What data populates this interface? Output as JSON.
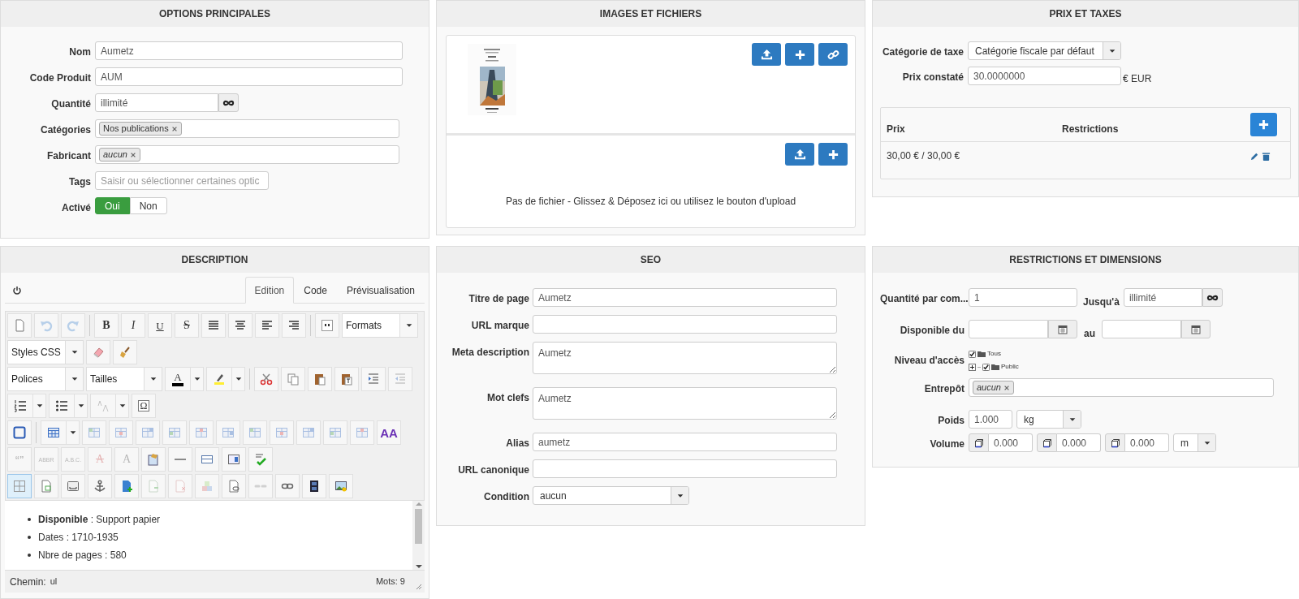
{
  "options": {
    "title": "OPTIONS PRINCIPALES",
    "fields": [
      {
        "kind": "text",
        "label": "Nom",
        "value": "Aumetz"
      },
      {
        "kind": "text",
        "label": "Code Produit",
        "value": "AUM"
      },
      {
        "kind": "unlimited",
        "label": "Quantité",
        "value": "illimité"
      },
      {
        "kind": "tags",
        "label": "Catégories",
        "tags": [
          {
            "text": "Nos publications",
            "italic": false
          }
        ]
      },
      {
        "kind": "tags",
        "label": "Fabricant",
        "tags": [
          {
            "text": "aucun",
            "italic": true
          }
        ]
      },
      {
        "kind": "short",
        "label": "Tags",
        "placeholder": "Saisir ou sélectionner certaines optic"
      },
      {
        "kind": "toggle",
        "label": "Activé",
        "options": [
          {
            "label": "Oui",
            "selected": true
          },
          {
            "label": "Non",
            "selected": false
          }
        ]
      }
    ]
  },
  "images": {
    "title": "IMAGES ET FICHIERS",
    "files_empty_text": "Pas de fichier - Glissez & Déposez ici ou utilisez le bouton d'upload"
  },
  "prices": {
    "title": "PRIX ET TAXES",
    "tax_category": {
      "label": "Catégorie de taxe",
      "value": "Catégorie fiscale par défaut"
    },
    "list_price": {
      "label": "Prix constaté",
      "value": "30.0000000",
      "unit": "€ EUR"
    },
    "table": {
      "columns": [
        "Prix",
        "Restrictions"
      ],
      "rows": [
        {
          "price": "30,00 € / 30,00 €"
        }
      ]
    }
  },
  "description": {
    "title": "DESCRIPTION",
    "tabs": [
      {
        "label": "Edition",
        "selected": true
      },
      {
        "label": "Code",
        "selected": false
      },
      {
        "label": "Prévisualisation",
        "selected": false
      }
    ],
    "toolbar": [
      [
        {
          "kind": "button",
          "disabled": false,
          "active": false
        },
        {
          "kind": "button",
          "disabled": true,
          "active": false
        },
        {
          "kind": "button",
          "disabled": true,
          "active": false
        },
        {
          "kind": "separator"
        },
        {
          "kind": "text",
          "label": "B",
          "disabled": false,
          "active": false
        },
        {
          "kind": "text",
          "label": "I",
          "disabled": false,
          "active": false
        },
        {
          "kind": "text",
          "label": "U",
          "disabled": false,
          "active": false
        },
        {
          "kind": "text",
          "label": "S",
          "disabled": false,
          "active": false
        },
        {
          "kind": "button",
          "disabled": false,
          "active": false
        },
        {
          "kind": "button",
          "disabled": false,
          "active": false
        },
        {
          "kind": "button",
          "disabled": false,
          "active": false
        },
        {
          "kind": "button",
          "disabled": false,
          "active": false
        },
        {
          "kind": "separator"
        },
        {
          "kind": "button",
          "disabled": false,
          "active": false
        },
        {
          "kind": "select",
          "label": "Formats"
        }
      ],
      [
        {
          "kind": "select",
          "label": "Styles CSS"
        },
        {
          "kind": "button",
          "disabled": false,
          "active": false
        },
        {
          "kind": "button",
          "disabled": false,
          "active": false
        }
      ],
      [
        {
          "kind": "select",
          "label": "Polices"
        },
        {
          "kind": "select",
          "label": "Tailles"
        },
        {
          "kind": "split",
          "label": "A",
          "disabled": false,
          "active": false
        },
        {
          "kind": "split",
          "disabled": false,
          "active": false
        },
        {
          "kind": "separator"
        },
        {
          "kind": "button",
          "disabled": false,
          "active": false
        },
        {
          "kind": "button",
          "disabled": false,
          "active": false
        },
        {
          "kind": "button",
          "disabled": false,
          "active": false
        },
        {
          "kind": "button",
          "disabled": false,
          "active": false
        },
        {
          "kind": "button",
          "disabled": false,
          "active": false
        },
        {
          "kind": "button",
          "disabled": true,
          "active": false
        }
      ],
      [
        {
          "kind": "split",
          "disabled": false,
          "active": false
        },
        {
          "kind": "split",
          "disabled": false,
          "active": false
        },
        {
          "kind": "split",
          "disabled": true,
          "active": false
        },
        {
          "kind": "text",
          "label": "Ω",
          "disabled": false,
          "active": false
        }
      ],
      [
        {
          "kind": "button",
          "disabled": false,
          "active": false
        },
        {
          "kind": "separator"
        },
        {
          "kind": "split",
          "disabled": false,
          "active": false
        },
        {
          "kind": "button",
          "disabled": true,
          "active": false
        },
        {
          "kind": "button",
          "disabled": true,
          "active": false
        },
        {
          "kind": "button",
          "disabled": true,
          "active": false
        },
        {
          "kind": "button",
          "disabled": true,
          "active": false
        },
        {
          "kind": "button",
          "disabled": true,
          "active": false
        },
        {
          "kind": "button",
          "disabled": true,
          "active": false
        },
        {
          "kind": "button",
          "disabled": true,
          "active": false
        },
        {
          "kind": "button",
          "disabled": true,
          "active": false
        },
        {
          "kind": "button",
          "disabled": true,
          "active": false
        },
        {
          "kind": "button",
          "disabled": true,
          "active": false
        },
        {
          "kind": "button",
          "disabled": true,
          "active": false
        },
        {
          "kind": "text",
          "label": "AA",
          "disabled": false,
          "active": false
        }
      ],
      [
        {
          "kind": "text",
          "label": "“”",
          "disabled": true,
          "active": false
        },
        {
          "kind": "text",
          "label": "ABBR",
          "disabled": true,
          "active": false
        },
        {
          "kind": "text",
          "label": "A.B.C.",
          "disabled": true,
          "active": false
        },
        {
          "kind": "text",
          "label": "A",
          "disabled": true,
          "active": false
        },
        {
          "kind": "text",
          "label": "A",
          "disabled": true,
          "active": false
        },
        {
          "kind": "button",
          "disabled": false,
          "active": false
        },
        {
          "kind": "button",
          "disabled": false,
          "active": false
        },
        {
          "kind": "button",
          "disabled": false,
          "active": false
        },
        {
          "kind": "button",
          "disabled": false,
          "active": false
        },
        {
          "kind": "button",
          "disabled": false,
          "active": false
        }
      ],
      [
        {
          "kind": "button",
          "disabled": false,
          "active": true
        },
        {
          "kind": "button",
          "disabled": false,
          "active": false
        },
        {
          "kind": "button",
          "disabled": false,
          "active": false
        },
        {
          "kind": "button",
          "disabled": false,
          "active": false
        },
        {
          "kind": "button",
          "disabled": false,
          "active": false
        },
        {
          "kind": "button",
          "disabled": true,
          "active": false
        },
        {
          "kind": "button",
          "disabled": true,
          "active": false
        },
        {
          "kind": "button",
          "disabled": true,
          "active": false
        },
        {
          "kind": "button",
          "disabled": false,
          "active": false
        },
        {
          "kind": "button",
          "disabled": true,
          "active": false
        },
        {
          "kind": "button",
          "disabled": false,
          "active": false
        },
        {
          "kind": "button",
          "disabled": false,
          "active": false
        },
        {
          "kind": "button",
          "disabled": false,
          "active": false
        }
      ]
    ],
    "content": [
      "**Disponible** : Support papier",
      "Dates : 1710-1935",
      "Nbre de pages : 580"
    ],
    "path_label": "Chemin:",
    "path": "ul",
    "word_count": "Mots: 9"
  },
  "seo": {
    "title": "SEO",
    "fields": [
      {
        "kind": "text",
        "label": "Titre de page",
        "value": "Aumetz"
      },
      {
        "kind": "text",
        "label": "URL marque"
      },
      {
        "kind": "textarea",
        "label": "Meta description",
        "value": "Aumetz"
      },
      {
        "kind": "textarea",
        "label": "Mot clefs",
        "value": "Aumetz"
      },
      {
        "kind": "text",
        "label": "Alias",
        "value": "aumetz"
      },
      {
        "kind": "text",
        "label": "URL canonique"
      },
      {
        "kind": "select",
        "label": "Condition",
        "value": "aucun"
      }
    ]
  },
  "restrictions": {
    "title": "RESTRICTIONS ET DIMENSIONS",
    "quantity": {
      "label": "Quantité par com...",
      "value": "1",
      "to_label": "Jusqu'à",
      "to_value": "illimité"
    },
    "availability": {
      "label": "Disponible du",
      "to_label": "au"
    },
    "access": {
      "label": "Niveau d'accès",
      "tree": [
        {
          "text": "Tous",
          "checked": true,
          "children": [
            {
              "text": "Public",
              "checked": true,
              "expanded": false
            }
          ]
        }
      ]
    },
    "warehouse": {
      "label": "Entrepôt",
      "tags": [
        {
          "text": "aucun",
          "italic": true
        }
      ]
    },
    "weight": {
      "label": "Poids",
      "value": "1.000",
      "unit": "kg"
    },
    "volume": {
      "label": "Volume",
      "values": [
        "0.000",
        "0.000",
        "0.000"
      ],
      "unit": "m"
    }
  }
}
